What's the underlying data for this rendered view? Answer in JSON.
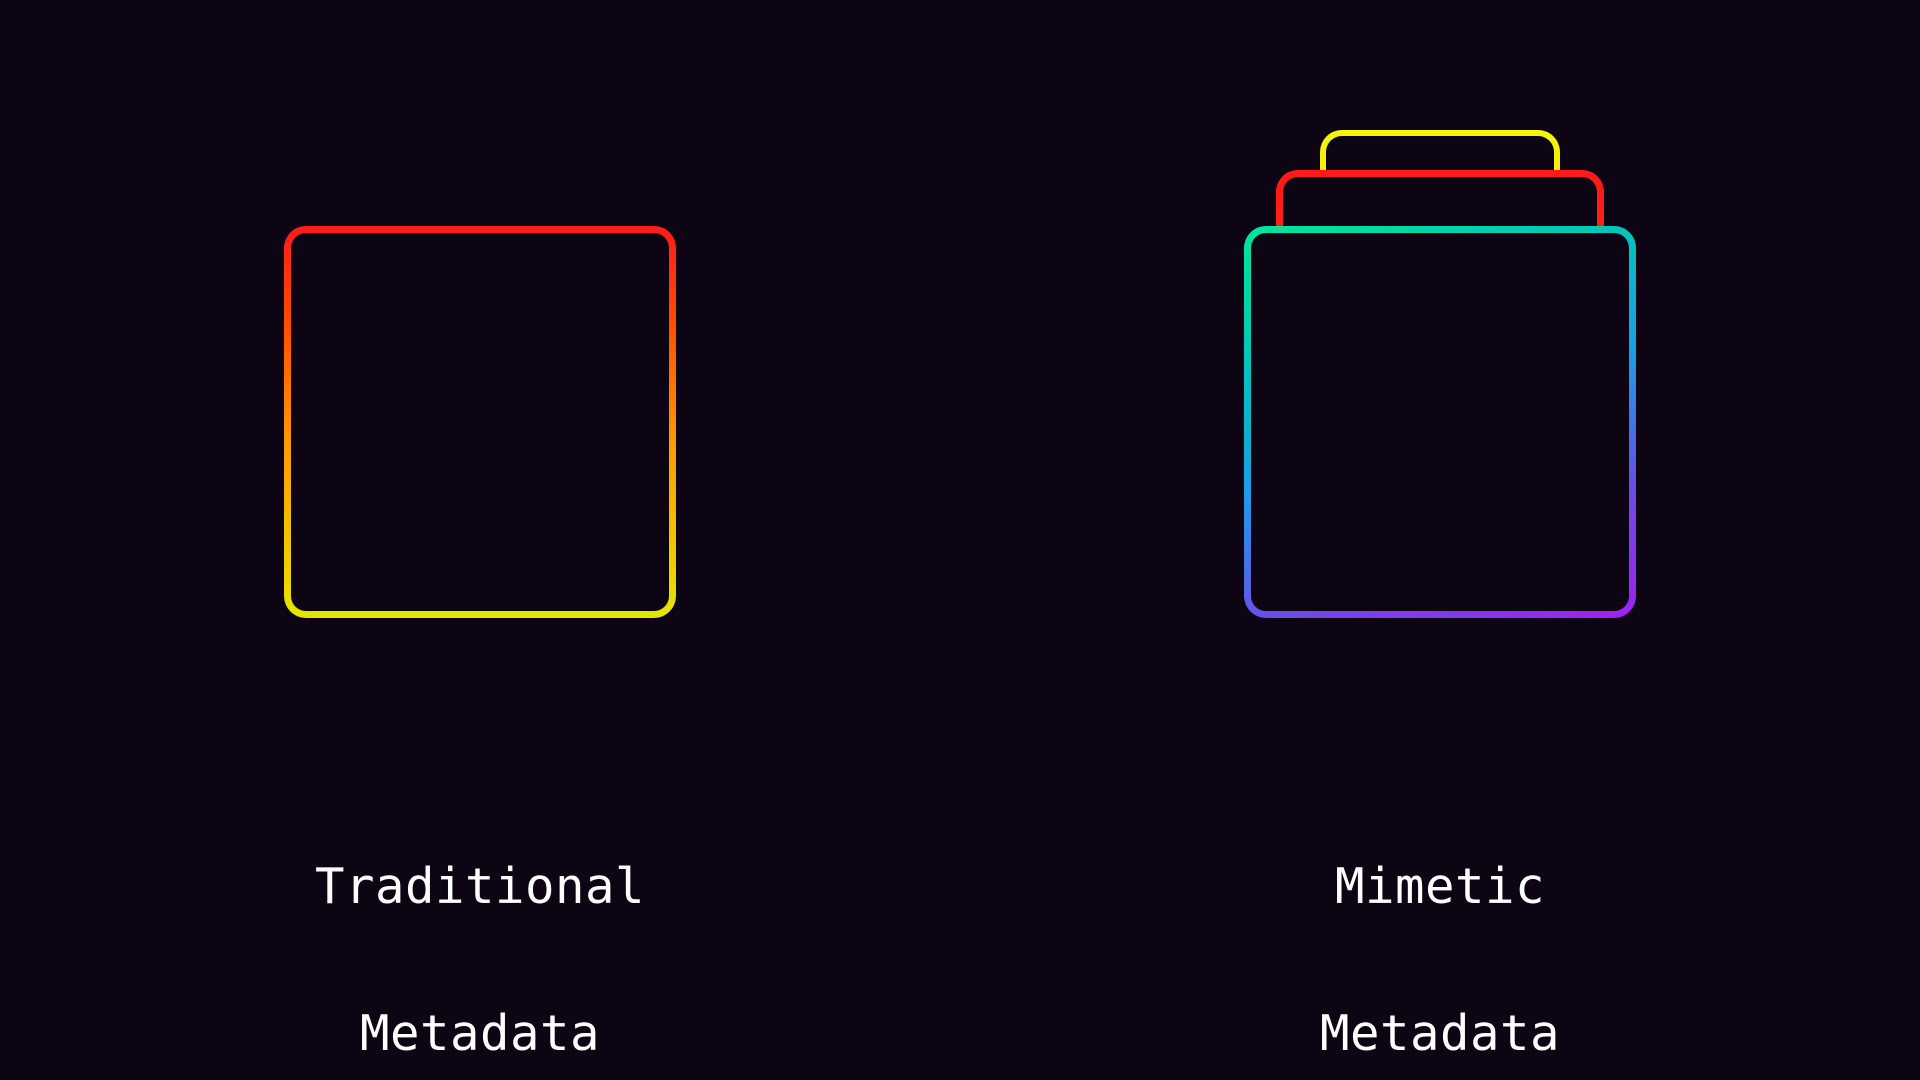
{
  "left": {
    "caption_line1": "Traditional",
    "caption_line2": "Metadata"
  },
  "right": {
    "caption_line1": "Mimetic",
    "caption_line2": "Metadata"
  },
  "colors": {
    "bg": "#0d0513",
    "red": "#ff1a1a",
    "yellow": "#e6e600",
    "green": "#00e69a",
    "blue": "#1a9de6",
    "violet": "#a020f0"
  }
}
